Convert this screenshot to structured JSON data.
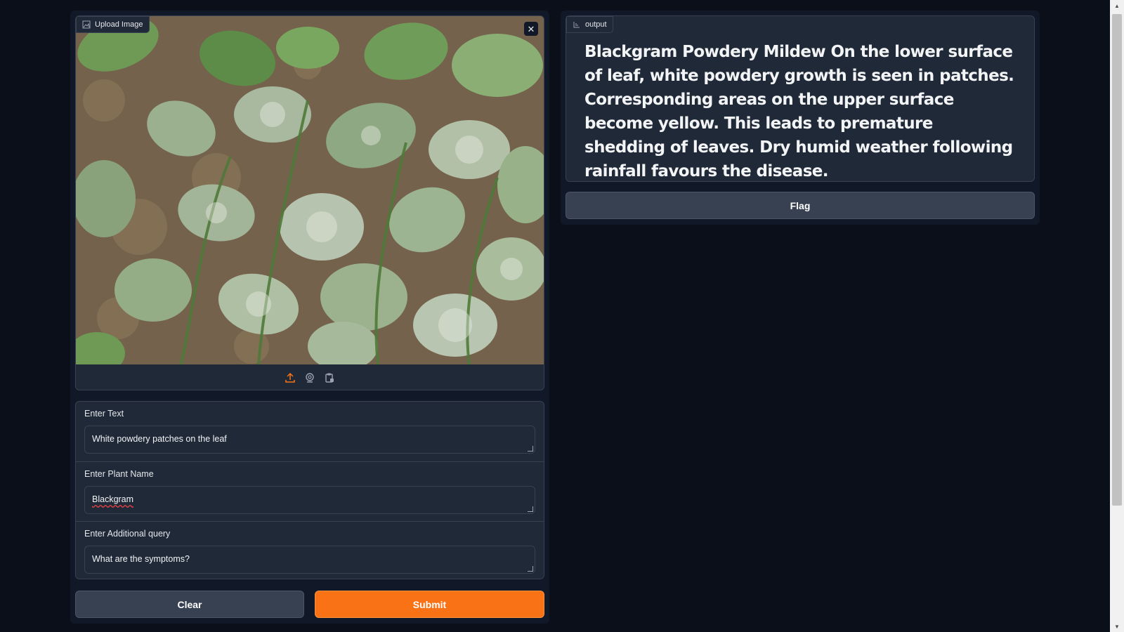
{
  "input_panel": {
    "image_label": "Upload Image",
    "image_close_icon": "close-icon",
    "image_description": "Blackgram plants with white powdery patches on leaves",
    "source_icons": [
      "upload-icon",
      "webcam-icon",
      "clipboard-icon"
    ],
    "fields": [
      {
        "label": "Enter Text",
        "value": "White powdery patches on the leaf"
      },
      {
        "label": "Enter Plant Name",
        "value": "Blackgram"
      },
      {
        "label": "Enter Additional query",
        "value": "What are the symptoms?"
      }
    ],
    "clear_label": "Clear",
    "submit_label": "Submit"
  },
  "output_panel": {
    "label": "output",
    "text": "Blackgram Powdery Mildew On the lower surface of leaf, white powdery growth is seen in patches. Corresponding areas on the upper surface become yellow. This leads to premature shedding of leaves. Dry humid weather following rainfall favours the disease.",
    "flag_label": "Flag"
  },
  "colors": {
    "background": "#0b0f19",
    "panel": "#111827",
    "block": "#1f2937",
    "border": "#374151",
    "accent": "#f97316"
  }
}
